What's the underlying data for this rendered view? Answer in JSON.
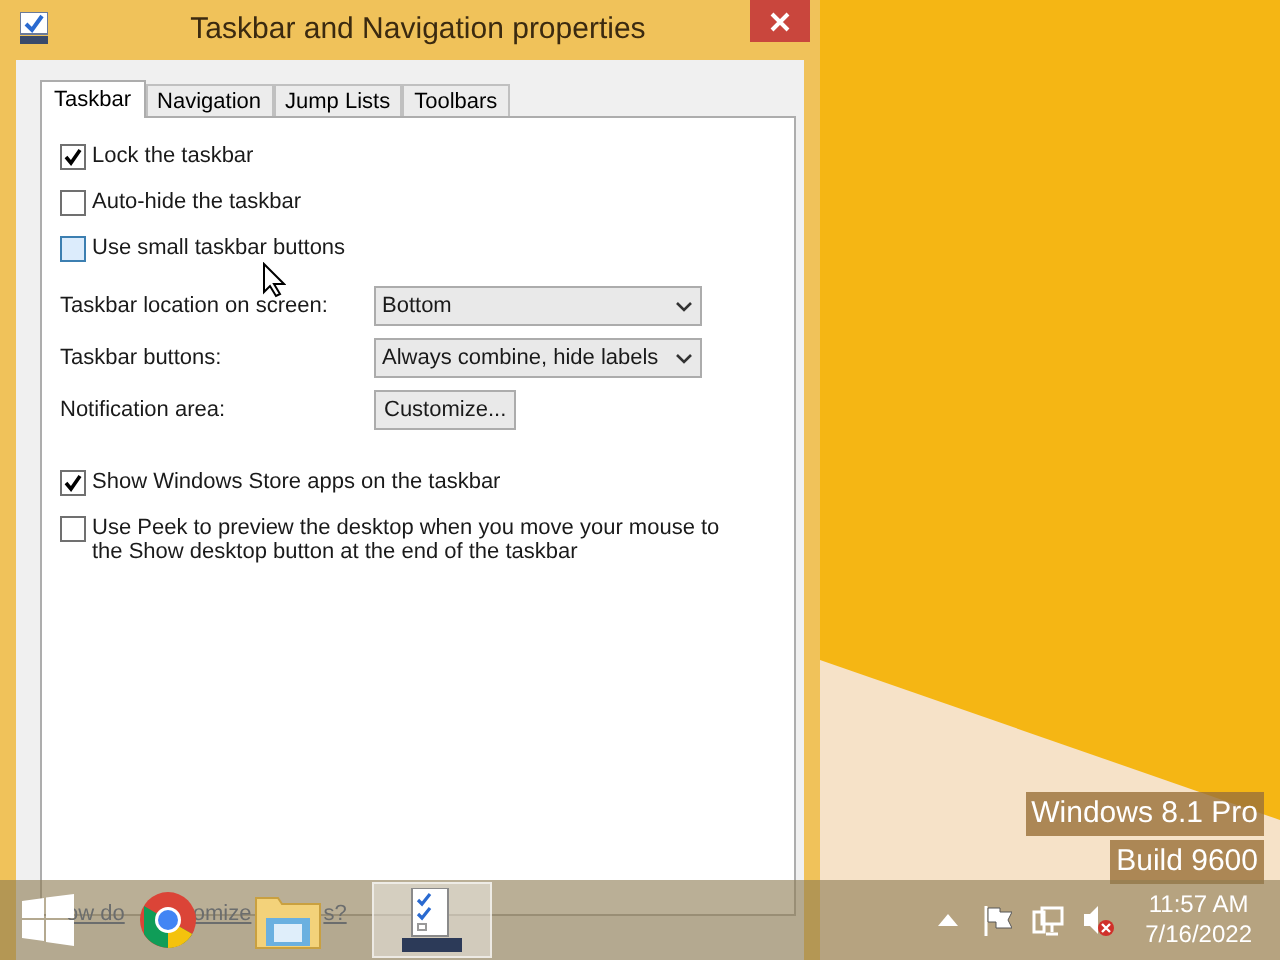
{
  "window": {
    "title": "Taskbar and Navigation properties"
  },
  "tabs": [
    {
      "label": "Taskbar",
      "selected": true
    },
    {
      "label": "Navigation",
      "selected": false
    },
    {
      "label": "Jump Lists",
      "selected": false
    },
    {
      "label": "Toolbars",
      "selected": false
    }
  ],
  "top_options": [
    {
      "label": "Lock the taskbar",
      "checked": true,
      "hovered": false
    },
    {
      "label": "Auto-hide the taskbar",
      "checked": false,
      "hovered": false
    },
    {
      "label": "Use small taskbar buttons",
      "checked": false,
      "hovered": true
    }
  ],
  "settings": [
    {
      "kind": "dropdown",
      "label": "Taskbar location on screen:",
      "value": "Bottom"
    },
    {
      "kind": "dropdown",
      "label": "Taskbar buttons:",
      "value": "Always combine, hide labels"
    },
    {
      "kind": "button",
      "label": "Notification area:",
      "value": "Customize..."
    }
  ],
  "bottom_options": [
    {
      "label": "Show Windows Store apps on the taskbar",
      "checked": true,
      "hovered": false
    },
    {
      "label": "Use Peek to preview the desktop when you move your mouse to the Show desktop button at the end of the taskbar",
      "checked": false,
      "hovered": false
    }
  ],
  "help_link_fragments": [
    "ow do",
    "omize",
    "s?"
  ],
  "desktop_text": [
    "Windows 8.1 Pro",
    "Build 9600"
  ],
  "taskbar": {
    "apps": [
      {
        "kind": "chrome",
        "selected": false
      },
      {
        "kind": "explorer",
        "selected": false
      },
      {
        "kind": "properties",
        "selected": true
      }
    ],
    "time": "11:57 AM",
    "date": "7/16/2022"
  }
}
